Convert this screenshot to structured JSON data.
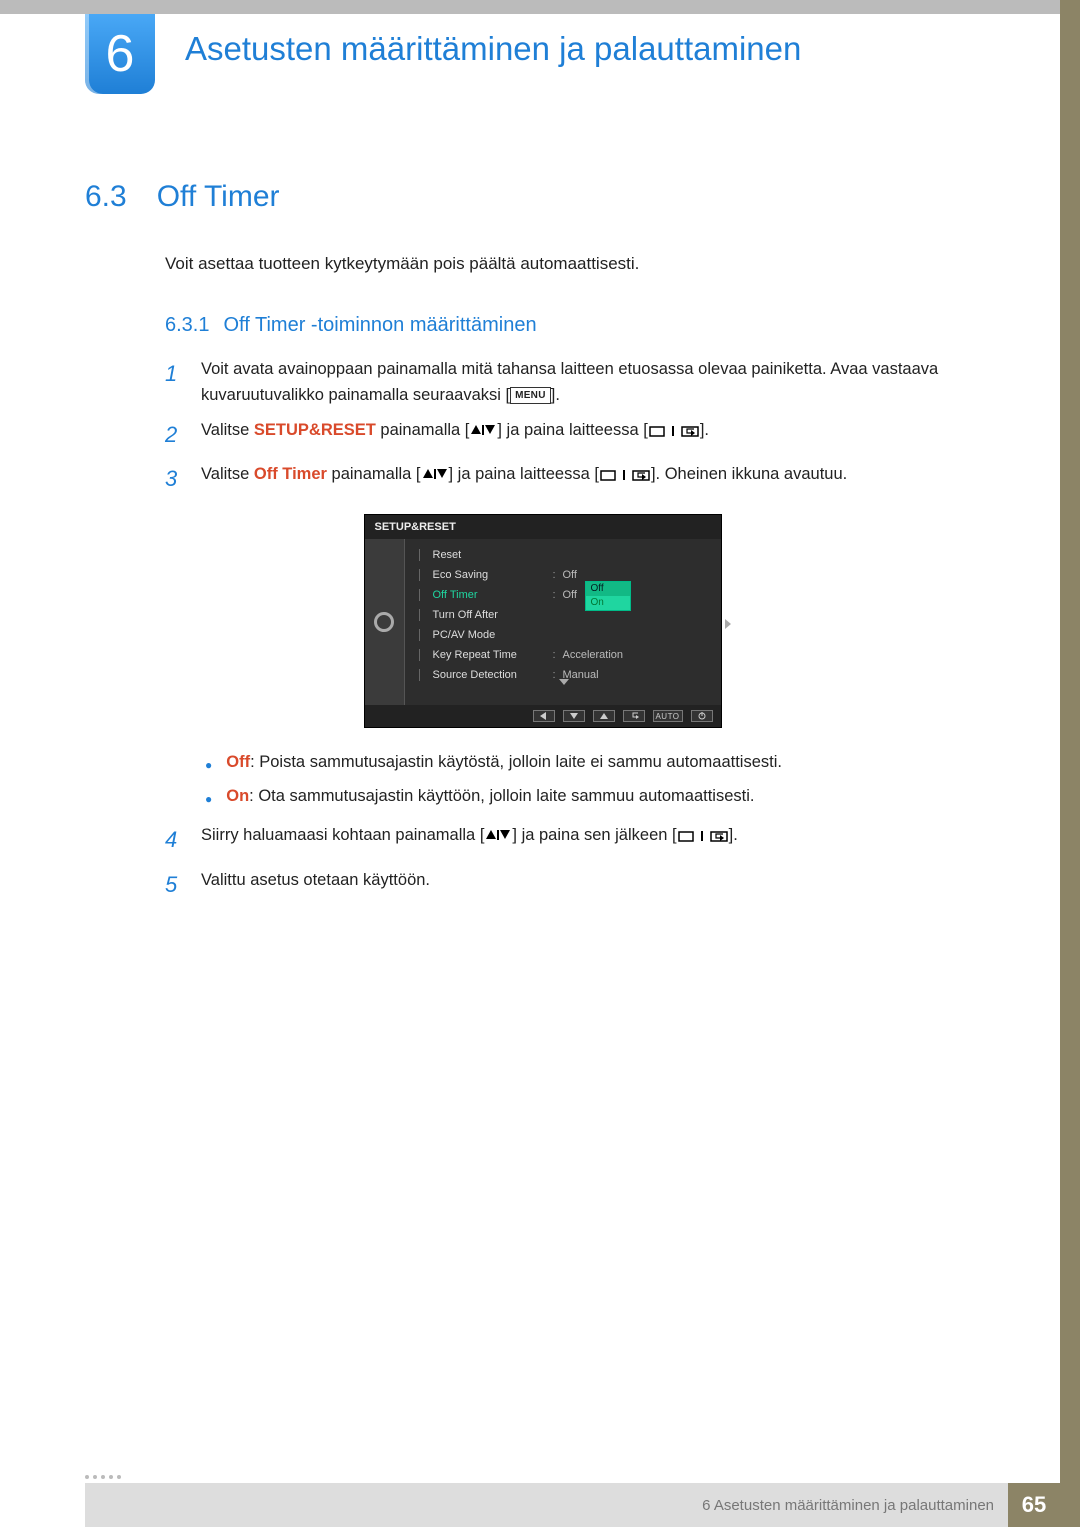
{
  "chapter": {
    "number": "6",
    "title": "Asetusten määrittäminen ja palauttaminen"
  },
  "section": {
    "number": "6.3",
    "title": "Off Timer"
  },
  "intro": "Voit asettaa tuotteen kytkeytymään pois päältä automaattisesti.",
  "subsection": {
    "number": "6.3.1",
    "title": "Off Timer -toiminnon määrittäminen"
  },
  "steps": {
    "s1": {
      "num": "1",
      "a": "Voit avata avainoppaan painamalla mitä tahansa laitteen etuosassa olevaa painiketta. Avaa vastaava kuvaruutuvalikko painamalla seuraavaksi [",
      "menu": "MENU",
      "b": "]."
    },
    "s2": {
      "num": "2",
      "a": "Valitse ",
      "kw": "SETUP&RESET",
      "b": " painamalla [",
      "c": "] ja paina laitteessa [",
      "d": "]."
    },
    "s3": {
      "num": "3",
      "a": "Valitse ",
      "kw": "Off Timer",
      "b": " painamalla [",
      "c": "] ja paina laitteessa [",
      "d": "]. Oheinen ikkuna avautuu."
    },
    "s4": {
      "num": "4",
      "a": "Siirry haluamaasi kohtaan painamalla [",
      "b": "] ja paina sen jälkeen [",
      "c": "]."
    },
    "s5": {
      "num": "5",
      "text": "Valittu asetus otetaan käyttöön."
    }
  },
  "bullets": {
    "off": {
      "kw": "Off",
      "text": ": Poista sammutusajastin käytöstä, jolloin laite ei sammu automaattisesti."
    },
    "on": {
      "kw": "On",
      "text": ": Ota sammutusajastin käyttöön, jolloin laite sammuu automaattisesti."
    }
  },
  "osd": {
    "title": "SETUP&RESET",
    "items": [
      {
        "name": "Reset",
        "val": ""
      },
      {
        "name": "Eco Saving",
        "val": "Off"
      },
      {
        "name": "Off Timer",
        "val": "Off",
        "active": true
      },
      {
        "name": "Turn Off After",
        "val": ""
      },
      {
        "name": "PC/AV Mode",
        "val": ""
      },
      {
        "name": "Key Repeat Time",
        "val": "Acceleration"
      },
      {
        "name": "Source Detection",
        "val": "Manual"
      }
    ],
    "popup": {
      "opt1": "Off",
      "opt2": "On"
    },
    "bottom": {
      "auto": "AUTO"
    }
  },
  "footer": {
    "crumb": "6 Asetusten määrittäminen ja palauttaminen",
    "page": "65"
  }
}
